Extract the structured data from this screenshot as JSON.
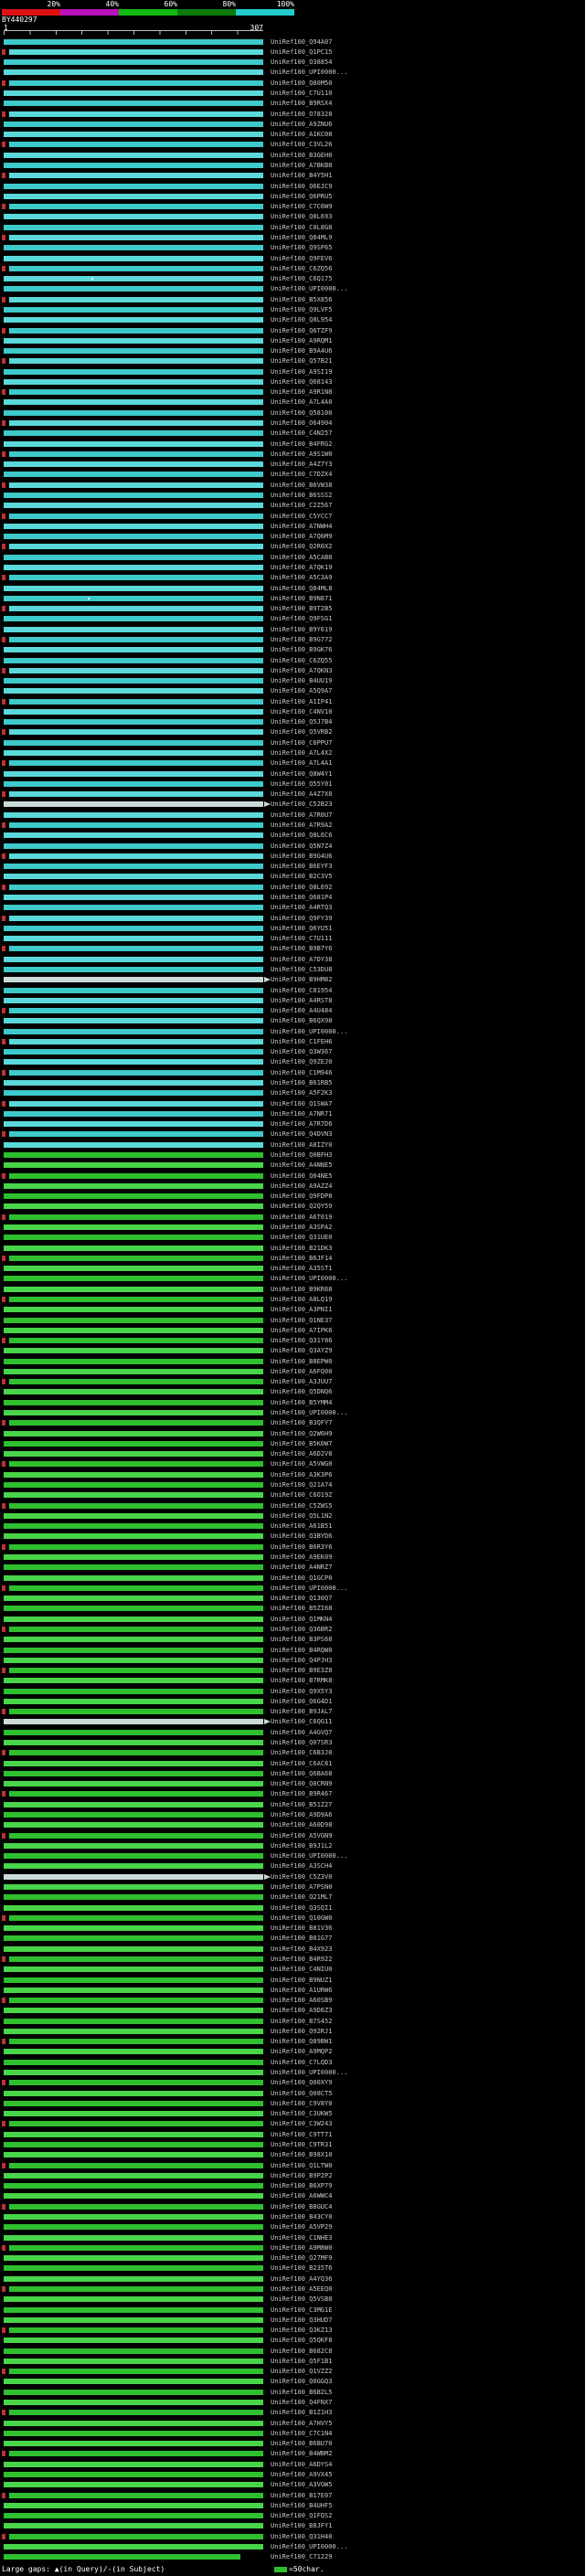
{
  "chart_data": {
    "type": "bar",
    "orientation": "horizontal",
    "title": "BY440297",
    "xlim": [
      1,
      307
    ],
    "x_tick_labels": [
      "1",
      "307"
    ],
    "grid": false,
    "legend": {
      "position": "top",
      "meaning": "percent identity color key",
      "labels": [
        "20%",
        "40%",
        "60%",
        "80%",
        "100%"
      ],
      "colors": [
        "#dd1111",
        "#bb11bb",
        "#11bb11",
        "#0b7a0b",
        "#22cccc"
      ]
    },
    "palette": {
      "cyan": [
        "#3ec9cb",
        "#5bd8da"
      ],
      "green": [
        "#2fbf2f",
        "#49d549"
      ],
      "light": "#ccd9d9",
      "tick": "#c03030",
      "gap_dot": "#ffffff"
    },
    "defaults": {
      "s": 1,
      "e": 307,
      "tick_start": 8
    },
    "rows": [
      {
        "l": "UniRef100_Q94A07",
        "c": 0
      },
      {
        "l": "UniRef100_Q1PC15",
        "c": 0,
        "t": 1
      },
      {
        "l": "UniRef100_O38854",
        "c": 0
      },
      {
        "l": "UniRef100_UPI0000...",
        "c": 0
      },
      {
        "l": "UniRef100_Q80M50",
        "c": 0,
        "t": 1
      },
      {
        "l": "UniRef100_C7U110",
        "c": 0
      },
      {
        "l": "UniRef100_B9RSX4",
        "c": 0
      },
      {
        "l": "UniRef100_O78328",
        "c": 0,
        "t": 1
      },
      {
        "l": "UniRef100_A9ZNU6",
        "c": 0
      },
      {
        "l": "UniRef100_A1KC08",
        "c": 0
      },
      {
        "l": "UniRef100_C3VL26",
        "c": 0,
        "t": 1
      },
      {
        "l": "UniRef100_B3GEH0",
        "c": 0
      },
      {
        "l": "UniRef100_A7BKB8",
        "c": 0
      },
      {
        "l": "UniRef100_B4Y5H1",
        "c": 0,
        "t": 1
      },
      {
        "l": "UniRef100_Q6EJC9",
        "c": 0
      },
      {
        "l": "UniRef100_Q6PRU5",
        "c": 0
      },
      {
        "l": "UniRef100_C7C6W9",
        "c": 0,
        "t": 1
      },
      {
        "l": "UniRef100_Q8L693",
        "c": 0
      },
      {
        "l": "UniRef100_C0L8G8",
        "c": 0
      },
      {
        "l": "UniRef100_Q84ML9",
        "c": 0,
        "t": 1
      },
      {
        "l": "UniRef100_Q9SP65",
        "c": 0
      },
      {
        "l": "UniRef100_Q9FEV6",
        "c": 0
      },
      {
        "l": "UniRef100_C6ZQ56",
        "c": 0,
        "t": 1
      },
      {
        "l": "UniRef100_C6Q175",
        "c": 0,
        "g": 105
      },
      {
        "l": "UniRef100_UPI0000...",
        "c": 0
      },
      {
        "l": "UniRef100_B5X856",
        "c": 0,
        "t": 1
      },
      {
        "l": "UniRef100_Q9LVF5",
        "c": 0
      },
      {
        "l": "UniRef100_Q8L954",
        "c": 0
      },
      {
        "l": "UniRef100_Q6TZF9",
        "c": 0,
        "t": 1
      },
      {
        "l": "UniRef100_A9RQM1",
        "c": 0
      },
      {
        "l": "UniRef100_B9A4U6",
        "c": 0
      },
      {
        "l": "UniRef100_Q57B21",
        "c": 0,
        "t": 1
      },
      {
        "l": "UniRef100_A9SI19",
        "c": 0
      },
      {
        "l": "UniRef100_Q68143",
        "c": 0
      },
      {
        "l": "UniRef100_A9R1N8",
        "c": 0,
        "t": 1
      },
      {
        "l": "UniRef100_A7L4A0",
        "c": 0
      },
      {
        "l": "UniRef100_Q58100",
        "c": 0
      },
      {
        "l": "UniRef100_O64904",
        "c": 0,
        "t": 1
      },
      {
        "l": "UniRef100_C4N257",
        "c": 0
      },
      {
        "l": "UniRef100_B4FRG2",
        "c": 0
      },
      {
        "l": "UniRef100_A9S1W0",
        "c": 0,
        "t": 1
      },
      {
        "l": "UniRef100_A4Z7Y3",
        "c": 0
      },
      {
        "l": "UniRef100_C7DZX4",
        "c": 0
      },
      {
        "l": "UniRef100_B6VW38",
        "c": 0,
        "t": 1
      },
      {
        "l": "UniRef100_B6SSS2",
        "c": 0
      },
      {
        "l": "UniRef100_C2Z567",
        "c": 0
      },
      {
        "l": "UniRef100_C5YCC7",
        "c": 0,
        "t": 1
      },
      {
        "l": "UniRef100_A7NWH4",
        "c": 0
      },
      {
        "l": "UniRef100_A7Q6M9",
        "c": 0
      },
      {
        "l": "UniRef100_Q2R0X2",
        "c": 0,
        "t": 1
      },
      {
        "l": "UniRef100_A5CAB8",
        "c": 0
      },
      {
        "l": "UniRef100_A7QK19",
        "c": 0
      },
      {
        "l": "UniRef100_A5C3A9",
        "c": 0,
        "t": 1
      },
      {
        "l": "UniRef100_Q84ML8",
        "c": 0
      },
      {
        "l": "UniRef100_B9N871",
        "c": 0,
        "g": 100
      },
      {
        "l": "UniRef100_B9T2B5",
        "c": 0,
        "t": 1
      },
      {
        "l": "UniRef100_Q9FSG1",
        "c": 0
      },
      {
        "l": "UniRef100_B9Y619",
        "c": 0
      },
      {
        "l": "UniRef100_B9G772",
        "c": 0,
        "t": 1
      },
      {
        "l": "UniRef100_B9GK76",
        "c": 0
      },
      {
        "l": "UniRef100_C6ZQ55",
        "c": 0
      },
      {
        "l": "UniRef100_A7QKN3",
        "c": 0,
        "t": 1
      },
      {
        "l": "UniRef100_B4UU19",
        "c": 0
      },
      {
        "l": "UniRef100_A5Q9A7",
        "c": 0
      },
      {
        "l": "UniRef100_A1IP41",
        "c": 0,
        "t": 1
      },
      {
        "l": "UniRef100_C4NV10",
        "c": 0
      },
      {
        "l": "UniRef100_Q5J7B4",
        "c": 0
      },
      {
        "l": "UniRef100_Q5VRB2",
        "c": 0,
        "t": 1
      },
      {
        "l": "UniRef100_C6PPU7",
        "c": 0
      },
      {
        "l": "UniRef100_A7L4X2",
        "c": 0
      },
      {
        "l": "UniRef100_A7L4A1",
        "c": 0,
        "t": 1
      },
      {
        "l": "UniRef100_Q8W4Y1",
        "c": 0
      },
      {
        "l": "UniRef100_Q55Y01",
        "c": 0
      },
      {
        "l": "UniRef100_A4Z7X8",
        "c": 0,
        "t": 1
      },
      {
        "l": "UniRef100_C52B23",
        "c": 2,
        "a": 1
      },
      {
        "l": "UniRef100_A7R0U7",
        "c": 0
      },
      {
        "l": "UniRef100_A7R9A2",
        "c": 0,
        "t": 1
      },
      {
        "l": "UniRef100_Q8L6C6",
        "c": 0
      },
      {
        "l": "UniRef100_Q5N7Z4",
        "c": 0
      },
      {
        "l": "UniRef100_B9G4U6",
        "c": 0,
        "t": 1
      },
      {
        "l": "UniRef100_B6EYF3",
        "c": 0
      },
      {
        "l": "UniRef100_B2C3V5",
        "c": 0
      },
      {
        "l": "UniRef100_Q8L692",
        "c": 0,
        "t": 1
      },
      {
        "l": "UniRef100_Q681P4",
        "c": 0
      },
      {
        "l": "UniRef100_A4RTQ3",
        "c": 0
      },
      {
        "l": "UniRef100_Q9FY39",
        "c": 0,
        "t": 1
      },
      {
        "l": "UniRef100_Q6YU51",
        "c": 0
      },
      {
        "l": "UniRef100_C7U111",
        "c": 0
      },
      {
        "l": "UniRef100_B9B7Y6",
        "c": 0,
        "t": 1
      },
      {
        "l": "UniRef100_A7DY38",
        "c": 0
      },
      {
        "l": "UniRef100_C53DU8",
        "c": 0
      },
      {
        "l": "UniRef100_B9HM82",
        "c": 2,
        "a": 1
      },
      {
        "l": "UniRef100_C81954",
        "c": 0
      },
      {
        "l": "UniRef100_A4RST8",
        "c": 0
      },
      {
        "l": "UniRef100_A4U484",
        "c": 0,
        "t": 1
      },
      {
        "l": "UniRef100_B6QX98",
        "c": 0
      },
      {
        "l": "UniRef100_UPI0000...",
        "c": 0
      },
      {
        "l": "UniRef100_C1FEH6",
        "c": 0,
        "t": 1
      },
      {
        "l": "UniRef100_Q3W367",
        "c": 0
      },
      {
        "l": "UniRef100_Q9ZEJ0",
        "c": 0
      },
      {
        "l": "UniRef100_C1M946",
        "c": 0,
        "t": 1
      },
      {
        "l": "UniRef100_B61RB5",
        "c": 0
      },
      {
        "l": "UniRef100_A5F2K3",
        "c": 0
      },
      {
        "l": "UniRef100_Q1SWA7",
        "c": 0,
        "t": 1
      },
      {
        "l": "UniRef100_A7NR71",
        "c": 0
      },
      {
        "l": "UniRef100_A7R7D6",
        "c": 0
      },
      {
        "l": "UniRef100_Q4DVN3",
        "c": 0,
        "t": 1
      },
      {
        "l": "UniRef100_A8IZY0",
        "c": 0
      },
      {
        "l": "UniRef100_Q0BFH3",
        "c": 1
      },
      {
        "l": "UniRef100_A4NNE5",
        "c": 1
      },
      {
        "l": "UniRef100_Q04NE5",
        "c": 1,
        "t": 1
      },
      {
        "l": "UniRef100_A9AZZ4",
        "c": 1
      },
      {
        "l": "UniRef100_Q9FDP8",
        "c": 1
      },
      {
        "l": "UniRef100_Q2QY59",
        "c": 1
      },
      {
        "l": "UniRef100_A6T019",
        "c": 1,
        "t": 1
      },
      {
        "l": "UniRef100_A3SPA2",
        "c": 1
      },
      {
        "l": "UniRef100_Q31UE0",
        "c": 1
      },
      {
        "l": "UniRef100_B21DK3",
        "c": 1
      },
      {
        "l": "UniRef100_B6JF14",
        "c": 1,
        "t": 1
      },
      {
        "l": "UniRef100_A35ST1",
        "c": 1
      },
      {
        "l": "UniRef100_UPI0000...",
        "c": 1
      },
      {
        "l": "UniRef100_B9KR68",
        "c": 1
      },
      {
        "l": "UniRef100_A8LQ19",
        "c": 1,
        "t": 1
      },
      {
        "l": "UniRef100_A3PNI1",
        "c": 1
      },
      {
        "l": "UniRef100_Q1NE37",
        "c": 1
      },
      {
        "l": "UniRef100_A7IPK6",
        "c": 1
      },
      {
        "l": "UniRef100_Q31Y86",
        "c": 1,
        "t": 1
      },
      {
        "l": "UniRef100_Q3AYZ9",
        "c": 1
      },
      {
        "l": "UniRef100_B8EPW0",
        "c": 1
      },
      {
        "l": "UniRef100_A6FQ00",
        "c": 1
      },
      {
        "l": "UniRef100_A3JUU7",
        "c": 1,
        "t": 1
      },
      {
        "l": "UniRef100_Q5DNQ6",
        "c": 1
      },
      {
        "l": "UniRef100_B5YMM4",
        "c": 1
      },
      {
        "l": "UniRef100_UPI0000...",
        "c": 1
      },
      {
        "l": "UniRef100_B3QFY7",
        "c": 1,
        "t": 1
      },
      {
        "l": "UniRef100_Q2W6H9",
        "c": 1
      },
      {
        "l": "UniRef100_B5K0W7",
        "c": 1
      },
      {
        "l": "UniRef100_A6D2V8",
        "c": 1
      },
      {
        "l": "UniRef100_A5VWG0",
        "c": 1,
        "t": 1
      },
      {
        "l": "UniRef100_A3K3P6",
        "c": 1
      },
      {
        "l": "UniRef100_Q21A74",
        "c": 1
      },
      {
        "l": "UniRef100_C6O19Z",
        "c": 1
      },
      {
        "l": "UniRef100_C5ZWS5",
        "c": 1,
        "t": 1
      },
      {
        "l": "UniRef100_Q5L1N2",
        "c": 1
      },
      {
        "l": "UniRef100_A61B51",
        "c": 1
      },
      {
        "l": "UniRef100_Q3BYD6",
        "c": 1
      },
      {
        "l": "UniRef100_B6R3Y6",
        "c": 1,
        "t": 1
      },
      {
        "l": "UniRef100_A9EK09",
        "c": 1
      },
      {
        "l": "UniRef100_A4NRZ7",
        "c": 1
      },
      {
        "l": "UniRef100_Q1GCP0",
        "c": 1
      },
      {
        "l": "UniRef100_UPI0000...",
        "c": 1,
        "t": 1
      },
      {
        "l": "UniRef100_Q130Q7",
        "c": 1
      },
      {
        "l": "UniRef100_B5ZI68",
        "c": 1
      },
      {
        "l": "UniRef100_Q1MKN4",
        "c": 1
      },
      {
        "l": "UniRef100_Q36BR2",
        "c": 1,
        "t": 1
      },
      {
        "l": "UniRef100_B3PS68",
        "c": 1
      },
      {
        "l": "UniRef100_B4RQW0",
        "c": 1
      },
      {
        "l": "UniRef100_Q4PJH3",
        "c": 1
      },
      {
        "l": "UniRef100_B9E3Z8",
        "c": 1,
        "t": 1
      },
      {
        "l": "UniRef100_B7RMK8",
        "c": 1
      },
      {
        "l": "UniRef100_Q9X5Y3",
        "c": 1
      },
      {
        "l": "UniRef100_Q6G4D1",
        "c": 1
      },
      {
        "l": "UniRef100_B9JAL7",
        "c": 1,
        "t": 1
      },
      {
        "l": "UniRef100_C6QG11",
        "c": 2,
        "a": 1
      },
      {
        "l": "UniRef100_A4GVQ7",
        "c": 1
      },
      {
        "l": "UniRef100_Q07SR3",
        "c": 1
      },
      {
        "l": "UniRef100_C6B3J0",
        "c": 1,
        "t": 1
      },
      {
        "l": "UniRef100_C6AC81",
        "c": 1
      },
      {
        "l": "UniRef100_Q6BA68",
        "c": 1
      },
      {
        "l": "UniRef100_Q0CRN9",
        "c": 1
      },
      {
        "l": "UniRef100_B9R467",
        "c": 1,
        "t": 1
      },
      {
        "l": "UniRef100_B51Z27",
        "c": 1
      },
      {
        "l": "UniRef100_A9D9A6",
        "c": 1
      },
      {
        "l": "UniRef100_A60D98",
        "c": 1
      },
      {
        "l": "UniRef100_A5VGN9",
        "c": 1,
        "t": 1
      },
      {
        "l": "UniRef100_B9J1L2",
        "c": 1
      },
      {
        "l": "UniRef100_UPI0000...",
        "c": 1
      },
      {
        "l": "UniRef100_A3SCH4",
        "c": 1
      },
      {
        "l": "UniRef100_C5Z3V0",
        "c": 2,
        "a": 1
      },
      {
        "l": "UniRef100_A7PSN0",
        "c": 1
      },
      {
        "l": "UniRef100_Q21ML7",
        "c": 1
      },
      {
        "l": "UniRef100_Q3SQI1",
        "c": 1
      },
      {
        "l": "UniRef100_Q10GW0",
        "c": 1,
        "t": 1
      },
      {
        "l": "UniRef100_B81V36",
        "c": 1
      },
      {
        "l": "UniRef100_B81G77",
        "c": 1
      },
      {
        "l": "UniRef100_B4X923",
        "c": 1
      },
      {
        "l": "UniRef100_B4R922",
        "c": 1,
        "t": 1
      },
      {
        "l": "UniRef100_C4NIU0",
        "c": 1
      },
      {
        "l": "UniRef100_B9NUZ1",
        "c": 1
      },
      {
        "l": "UniRef100_A1URW6",
        "c": 1
      },
      {
        "l": "UniRef100_A60SB9",
        "c": 1,
        "t": 1
      },
      {
        "l": "UniRef100_A9D6Z3",
        "c": 1
      },
      {
        "l": "UniRef100_B7S452",
        "c": 1
      },
      {
        "l": "UniRef100_Q92RJ1",
        "c": 1
      },
      {
        "l": "UniRef100_Q89BW1",
        "c": 1,
        "t": 1
      },
      {
        "l": "UniRef100_A9MQP2",
        "c": 1
      },
      {
        "l": "UniRef100_C7LQD3",
        "c": 1
      },
      {
        "l": "UniRef100_UPI0000...",
        "c": 1
      },
      {
        "l": "UniRef100_Q00XY9",
        "c": 1,
        "t": 1
      },
      {
        "l": "UniRef100_Q08CT5",
        "c": 1
      },
      {
        "l": "UniRef100_C9V8Y0",
        "c": 1
      },
      {
        "l": "UniRef100_C3UKW5",
        "c": 1
      },
      {
        "l": "UniRef100_C3W243",
        "c": 1,
        "t": 1
      },
      {
        "l": "UniRef100_C9TT71",
        "c": 1
      },
      {
        "l": "UniRef100_C9TR31",
        "c": 1
      },
      {
        "l": "UniRef100_B98X10",
        "c": 1
      },
      {
        "l": "UniRef100_Q1LTW0",
        "c": 1,
        "t": 1
      },
      {
        "l": "UniRef100_B9P2P2",
        "c": 1
      },
      {
        "l": "UniRef100_B6XP79",
        "c": 1
      },
      {
        "l": "UniRef100_A6WWC4",
        "c": 1
      },
      {
        "l": "UniRef100_B8GUC4",
        "c": 1,
        "t": 1
      },
      {
        "l": "UniRef100_B43CY0",
        "c": 1
      },
      {
        "l": "UniRef100_A5VP29",
        "c": 1
      },
      {
        "l": "UniRef100_C1NHE3",
        "c": 1
      },
      {
        "l": "UniRef100_A9M8W0",
        "c": 1,
        "t": 1
      },
      {
        "l": "UniRef100_Q27MF9",
        "c": 1
      },
      {
        "l": "UniRef100_B235T6",
        "c": 1
      },
      {
        "l": "UniRef100_A4YQ36",
        "c": 1
      },
      {
        "l": "UniRef100_A5EEQ0",
        "c": 1,
        "t": 1
      },
      {
        "l": "UniRef100_Q5VSB8",
        "c": 1
      },
      {
        "l": "UniRef100_C3MG1E",
        "c": 1
      },
      {
        "l": "UniRef100_Q3HUD7",
        "c": 1
      },
      {
        "l": "UniRef100_Q3KZ13",
        "c": 1,
        "t": 1
      },
      {
        "l": "UniRef100_Q5QKF8",
        "c": 1
      },
      {
        "l": "UniRef100_B682C8",
        "c": 1
      },
      {
        "l": "UniRef100_Q5F1B1",
        "c": 1
      },
      {
        "l": "UniRef100_Q1VZZ2",
        "c": 1,
        "t": 1
      },
      {
        "l": "UniRef100_Q0GGQ3",
        "c": 1
      },
      {
        "l": "UniRef100_B6B2L5",
        "c": 1
      },
      {
        "l": "UniRef100_Q4FNX7",
        "c": 1
      },
      {
        "l": "UniRef100_B1Z1H3",
        "c": 1,
        "t": 1
      },
      {
        "l": "UniRef100_A7HVY5",
        "c": 1
      },
      {
        "l": "UniRef100_C7C1N4",
        "c": 1
      },
      {
        "l": "UniRef100_B6BU70",
        "c": 1
      },
      {
        "l": "UniRef100_B4WBM2",
        "c": 1,
        "t": 1
      },
      {
        "l": "UniRef100_A6DYS4",
        "c": 1
      },
      {
        "l": "UniRef100_A9VX45",
        "c": 1
      },
      {
        "l": "UniRef100_A3VGW5",
        "c": 1
      },
      {
        "l": "UniRef100_B17E07",
        "c": 1,
        "t": 1
      },
      {
        "l": "UniRef100_B4UHF5",
        "c": 1
      },
      {
        "l": "UniRef100_Q1FQS2",
        "c": 1
      },
      {
        "l": "UniRef100_B8JFY1",
        "c": 1
      },
      {
        "l": "UniRef100_Q31H40",
        "c": 1,
        "t": 1
      },
      {
        "l": "UniRef100_UPI0000...",
        "c": 1
      },
      {
        "l": "UniRef100_C71229",
        "c": 1,
        "e": 280
      }
    ]
  },
  "query": {
    "name": "BY440297",
    "start": "1",
    "end": "307"
  },
  "footer": {
    "gaps_legend": "Large gaps: ▲(in Query)/-(in Subject)",
    "scale_label": "=50char."
  }
}
